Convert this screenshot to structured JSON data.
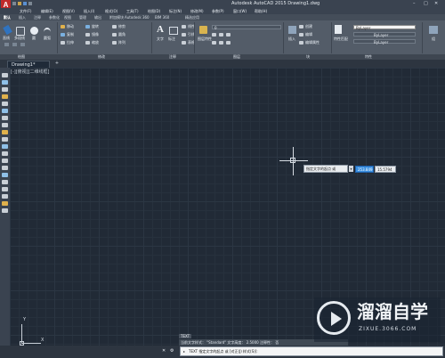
{
  "window": {
    "title": "Autodesk AutoCAD 2015    Drawing1.dwg",
    "logo_letter": "A"
  },
  "menu": {
    "items": [
      "文件(F)",
      "编辑(E)",
      "视图(V)",
      "插入(I)",
      "格式(O)",
      "工具(T)",
      "绘图(D)",
      "标注(N)",
      "修改(M)",
      "参数(P)",
      "窗口(W)",
      "帮助(H)"
    ]
  },
  "ribbon_tabs": [
    "默认",
    "插入",
    "注释",
    "参数化",
    "视图",
    "管理",
    "输出",
    "附加模块",
    "Autodesk 360",
    "BIM 360",
    "精选应用"
  ],
  "ribbon": {
    "draw": {
      "line": "直线",
      "polyline": "多段线",
      "circle": "圆",
      "arc": "圆弧"
    },
    "modify": {
      "move": "移动",
      "rotate": "旋转",
      "trim": "修剪",
      "copy": "复制",
      "mirror": "镜像",
      "fillet": "圆角",
      "stretch": "拉伸",
      "scale": "缩放",
      "array": "阵列"
    },
    "annotation": {
      "text": "文字",
      "dimension": "标注",
      "linear": "线性",
      "leader": "引线",
      "table": "表格"
    },
    "layers": {
      "layer_props": "图层特性",
      "layer_value": "0"
    },
    "block": {
      "insert": "插入",
      "create": "创建",
      "edit": "编辑",
      "edit_attr": "编辑属性"
    },
    "properties": {
      "match": "特性匹配",
      "color": "ByLayer",
      "linetype": "ByLayer",
      "lineweight": "ByLayer"
    },
    "groups": {
      "group": "组"
    }
  },
  "panel_labels": {
    "draw": "绘图",
    "modify": "修改",
    "annotation": "注释",
    "layers": "图层",
    "block": "块",
    "properties": "特性"
  },
  "doc_tabs": {
    "active": "Drawing1*",
    "new": "+"
  },
  "viewport_label": "[-][俯视][二维线框]",
  "prompt": {
    "label": "指定文字的起点 或",
    "x_value": "253.849",
    "y_value": "15.5794"
  },
  "history": {
    "command": "TEXT",
    "line": "当前文字样式： \"Standard\"  文字高度： 2.5000  注释性： 否"
  },
  "command_line": {
    "text": "TEXT 指定文字的起点 或 [对正(J) 样式(S)]:"
  },
  "ucs": {
    "x": "X",
    "y": "Y"
  },
  "watermark": {
    "name": "溜溜自学",
    "url": "ZIXUE.3066.COM"
  },
  "colors": {
    "canvas": "#212a36",
    "ribbon": "#535c68",
    "accent": "#c02a2a",
    "input_highlight": "#3a8fe0"
  }
}
